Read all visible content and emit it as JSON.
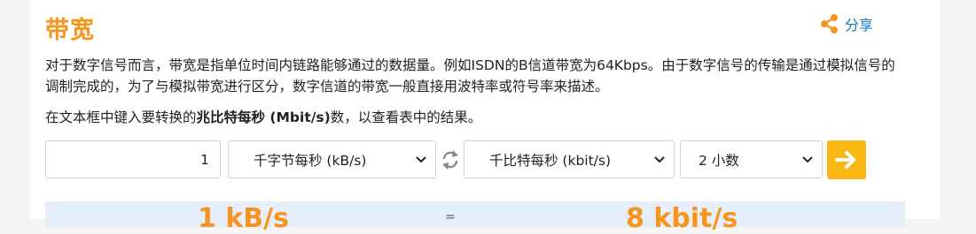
{
  "page": {
    "title": "带宽",
    "share_label": "分享",
    "description": "对于数字信号而言，带宽是指单位时间内链路能够通过的数据量。例如ISDN的B信道带宽为64Kbps。由于数字信号的传输是通过模拟信号的调制完成的，为了与模拟带宽进行区分，数字信道的带宽一般直接用波特率或符号率来描述。",
    "instruction_prefix": "在文本框中键入要转换的",
    "instruction_unit": "兆比特每秒 (Mbit/s)",
    "instruction_suffix": "数，以查看表中的结果。"
  },
  "converter": {
    "input_value": "1",
    "from_unit": "千字节每秒 (kB/s)",
    "to_unit": "千比特每秒 (kbit/s)",
    "decimals": "2 小数"
  },
  "result": {
    "left": "1 kB/s",
    "middle": "=",
    "right": "8 kbit/s"
  },
  "colors": {
    "accent_orange": "#f7941d",
    "button_yellow": "#f9b712",
    "link_blue": "#1a73b8",
    "result_bg": "#e6eefa"
  },
  "icons": {
    "share": "share-icon",
    "swap": "swap-icon",
    "go": "arrow-right-icon",
    "chevron": "chevron-down-icon"
  }
}
